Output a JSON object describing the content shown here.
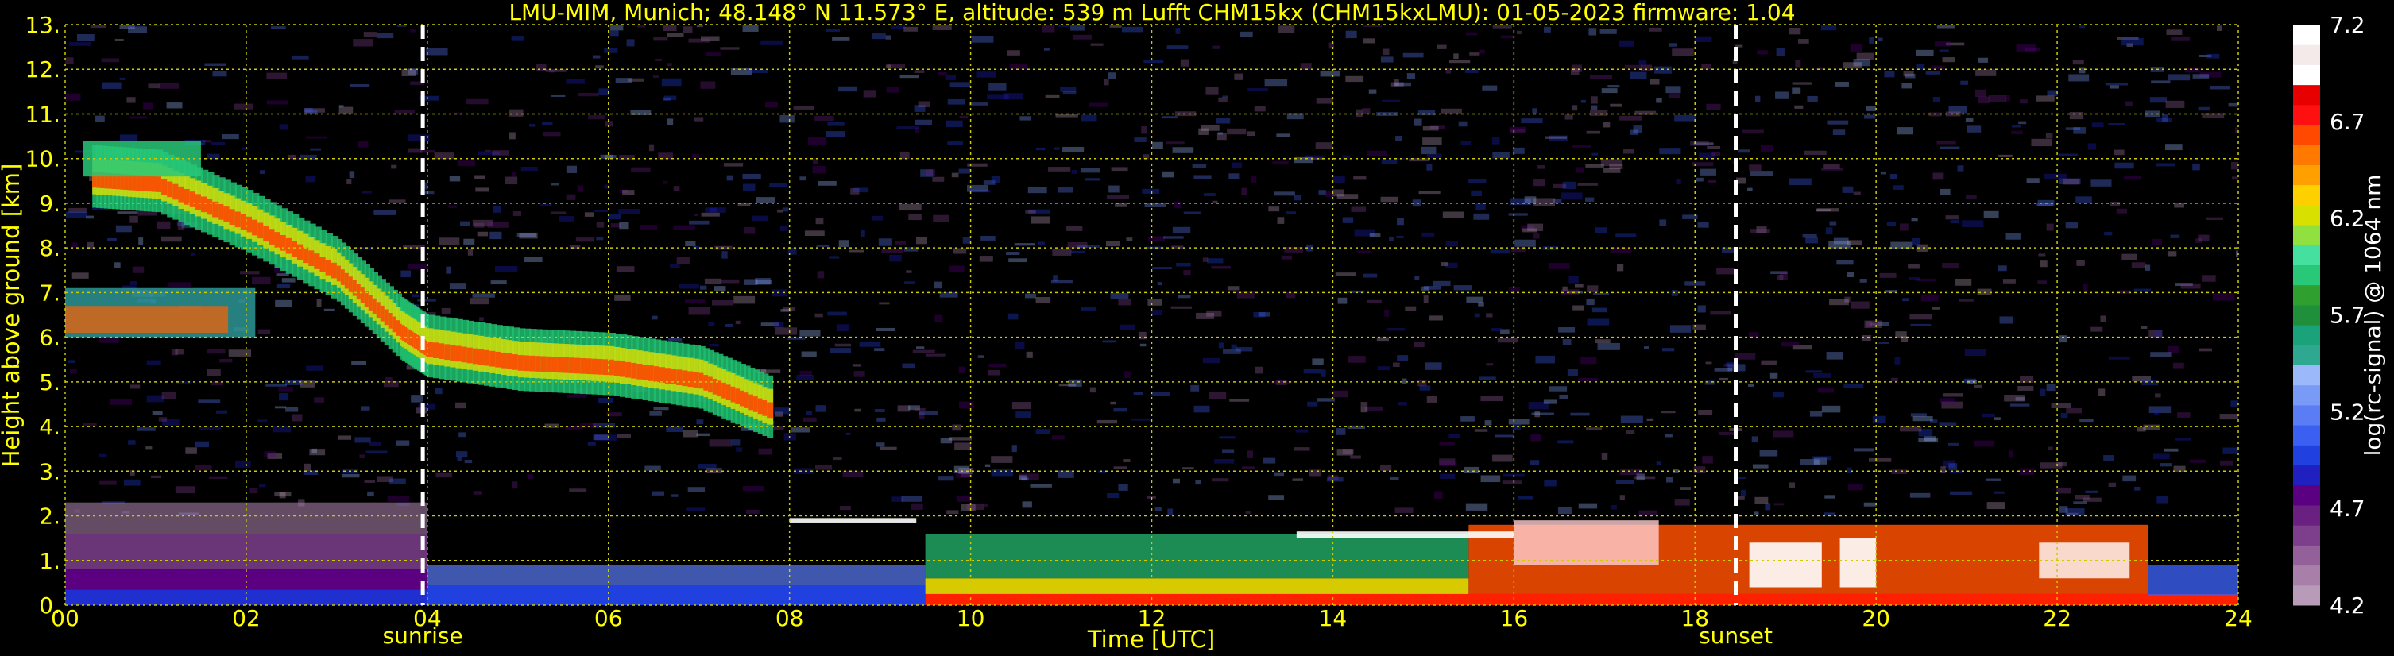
{
  "title": "LMU-MIM, Munich; 48.148° N 11.573° E, altitude: 539 m    Lufft CHM15kx (CHM15kxLMU): 01-05-2023    firmware: 1.04",
  "colors": {
    "background": "#000000",
    "text": "#ffff00",
    "grid": "#cccc00",
    "event_line": "#ffffff",
    "colorbar": [
      "#b89bb8",
      "#a77fa8",
      "#94609a",
      "#7d3f8c",
      "#6a2080",
      "#5a0080",
      "#2020c0",
      "#2040e0",
      "#3b5ff0",
      "#5a7cf5",
      "#7a9af8",
      "#9ab8fa",
      "#2ea890",
      "#1aa37a",
      "#1f8f3c",
      "#2fa030",
      "#28c878",
      "#45e0a0",
      "#90e040",
      "#d8e000",
      "#ffd000",
      "#ffa000",
      "#ff7800",
      "#ff4800",
      "#ff1010",
      "#e80000",
      "#ffffff",
      "#f4eaea",
      "#ffffff"
    ]
  },
  "chart_data": {
    "type": "heatmap",
    "title": "LMU-MIM, Munich; 48.148° N 11.573° E, altitude: 539 m    Lufft CHM15kx (CHM15kxLMU): 01-05-2023    firmware: 1.04",
    "xlabel": "Time [UTC]",
    "ylabel": "Height above ground [km]",
    "xlim": [
      0,
      24
    ],
    "ylim": [
      0,
      13
    ],
    "xticks": [
      "00",
      "02",
      "04",
      "06",
      "08",
      "10",
      "12",
      "14",
      "16",
      "18",
      "20",
      "22",
      "24"
    ],
    "yticks": [
      "0.",
      "1.",
      "2.",
      "3.",
      "4.",
      "5.",
      "6.",
      "7.",
      "8.",
      "9.",
      "10.",
      "11.",
      "12.",
      "13."
    ],
    "grid": true,
    "colorbar": {
      "label": "log(rc-signal) @ 1064 nm",
      "range": [
        4.2,
        7.2
      ],
      "ticks": [
        "4.2",
        "4.7",
        "5.2",
        "5.7",
        "6.2",
        "6.7",
        "7.2"
      ]
    },
    "events": [
      {
        "label": "sunrise",
        "x": 3.95
      },
      {
        "label": "sunset",
        "x": 18.45
      }
    ]
  }
}
